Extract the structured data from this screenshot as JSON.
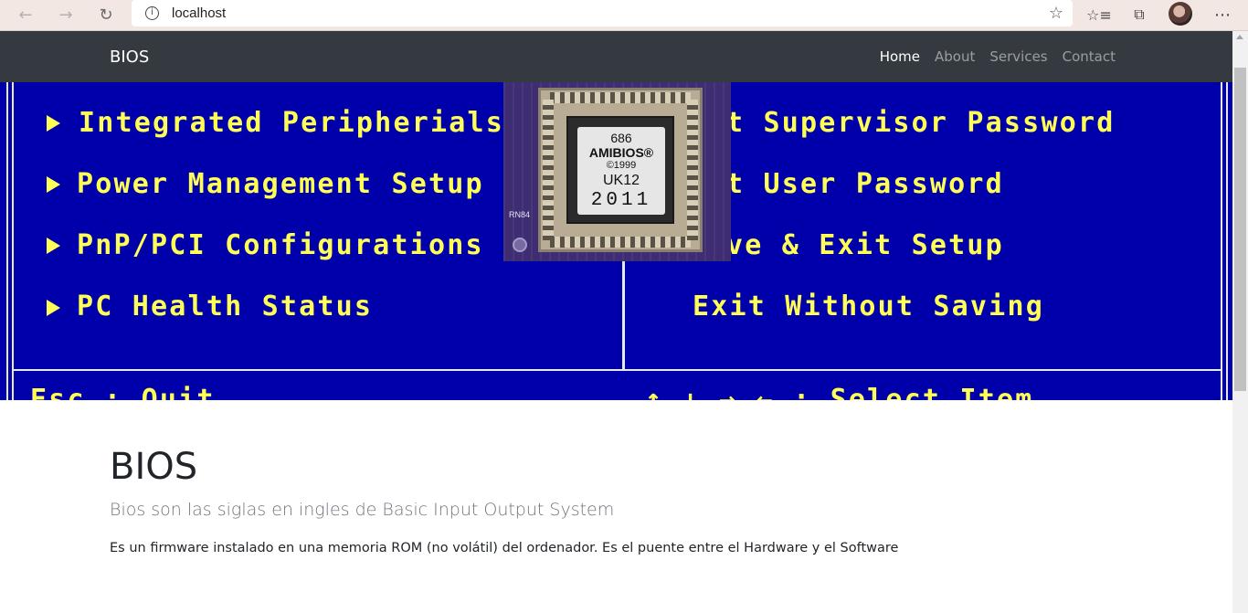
{
  "browser": {
    "back_icon": "arrow-left",
    "forward_icon": "arrow-right",
    "refresh_icon": "refresh",
    "url": "localhost",
    "favorite_icon": "star",
    "menu_icon": "more"
  },
  "navbar": {
    "brand": "BIOS",
    "links": [
      "Home",
      "About",
      "Services",
      "Contact"
    ],
    "active": "Home"
  },
  "hero": {
    "left_items": [
      "Integrated Peripherials",
      "Power Management Setup",
      "PnP/PCI Configurations",
      "PC Health Status"
    ],
    "right_items": [
      "t Supervisor Password",
      "t User Password",
      "ve & Exit Setup",
      "Exit Without Saving"
    ],
    "footer_left": "Esc : Quit",
    "footer_right": "↑ ↓ → ← : Select Item",
    "chip_label": [
      "686",
      "AMIBIOS®",
      "©1999",
      "UK12",
      "2011"
    ],
    "chip_marking": "RN84"
  },
  "content": {
    "title": "BIOS",
    "lead": "Bios son las siglas en ingles de Basic Input Output System",
    "text": "Es un firmware instalado en una memoria ROM (no volátil) del ordenador. Es el puente entre el Hardware y el Software"
  }
}
